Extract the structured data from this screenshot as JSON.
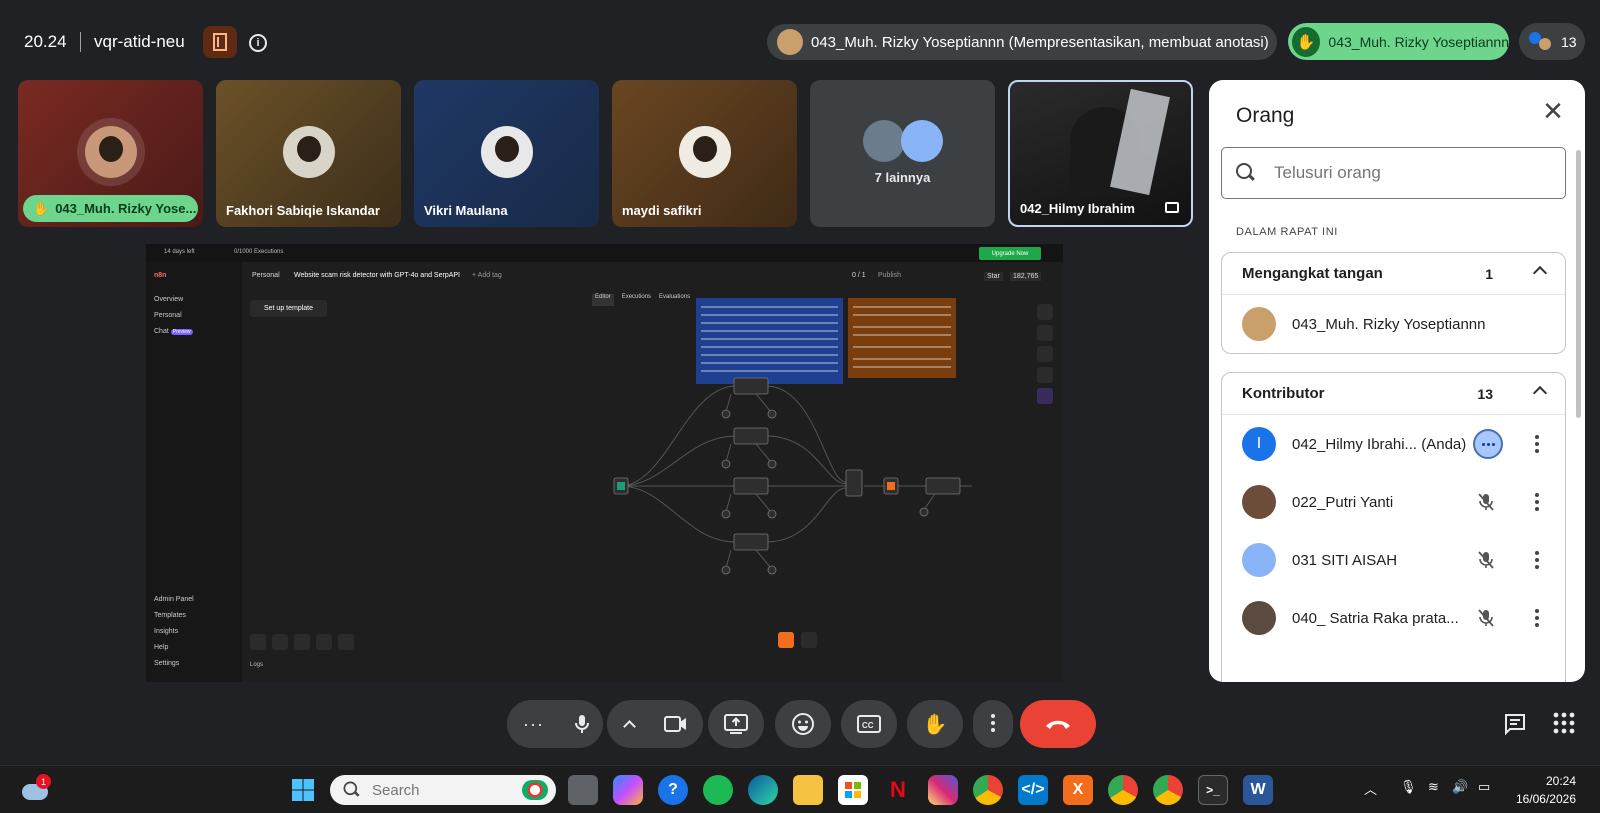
{
  "header": {
    "time": "20.24",
    "meeting_code": "vqr-atid-neu",
    "presenting_chip": "043_Muh. Rizky Yoseptiannn (Mempresentasikan, membuat anotasi)",
    "raised_hand_chip": "043_Muh. Rizky Yoseptiannn",
    "participant_count": "13"
  },
  "tiles": [
    {
      "name": "043_Muh. Rizky Yose...",
      "hand_raised": true
    },
    {
      "name": "Fakhori Sabiqie Iskandar"
    },
    {
      "name": "Vikri Maulana"
    },
    {
      "name": "maydi safikri"
    },
    {
      "name": "7 lainnya"
    },
    {
      "name": "042_Hilmy Ibrahim"
    }
  ],
  "shared_screen": {
    "trial": "14 days left",
    "executions": "0/1000 Executions",
    "upgrade": "Upgrade Now",
    "app": "n8n",
    "breadcrumb_personal": "Personal",
    "workflow_title": "Website scam risk detector with GPT-4o and SerpAPI",
    "add_tag": "+ Add tag",
    "version": "0 / 1",
    "publish": "Publish",
    "star": "Star",
    "star_count": "182,765",
    "tabs": [
      "Editor",
      "Executions",
      "Evaluations"
    ],
    "sidebar": [
      "Overview",
      "Personal",
      "Chat"
    ],
    "chat_badge": "Preview",
    "sidebar_bottom": [
      "Admin Panel",
      "Templates",
      "Insights",
      "Help",
      "Settings"
    ],
    "setup_template": "Set up template",
    "logs": "Logs"
  },
  "panel": {
    "title": "Orang",
    "search_placeholder": "Telusuri orang",
    "section": "DALAM RAPAT INI",
    "raised_group": {
      "label": "Mengangkat tangan",
      "count": "1",
      "members": [
        "043_Muh. Rizky Yoseptiannn"
      ]
    },
    "contrib_group": {
      "label": "Kontributor",
      "count": "13",
      "members": [
        {
          "name": "042_Hilmy Ibrahi... (Anda)",
          "initial": "I",
          "color": "#1a73e8"
        },
        {
          "name": "022_Putri Yanti",
          "initial": "",
          "color": "#6b4d3a"
        },
        {
          "name": "031 SITI AISAH",
          "initial": "",
          "color": "#8ab4f8"
        },
        {
          "name": "040_ Satria Raka prata...",
          "initial": "",
          "color": "#5a4a40"
        }
      ]
    }
  },
  "taskbar": {
    "search_placeholder": "Search",
    "weather_badge": "1",
    "clock_time": "20:24",
    "clock_date": "16/06/2026"
  },
  "colors": {
    "meet_bg": "#202124",
    "raised_green": "#6dd58c",
    "end_call_red": "#ea4335",
    "upgrade_green": "#1fa84a"
  }
}
